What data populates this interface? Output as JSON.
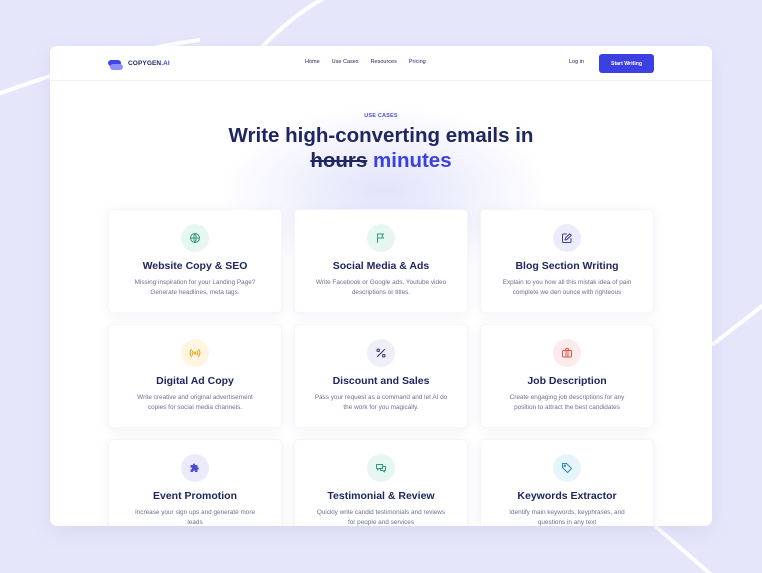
{
  "colors": {
    "accent": "#3d40e0",
    "heading": "#1f2660",
    "page_background": "#e6e6fb"
  },
  "header": {
    "logo_main": "COPYGEN",
    "logo_suffix": ".AI",
    "nav": [
      "Home",
      "Use Cases",
      "Resources",
      "Pricing"
    ],
    "login": "Log in",
    "cta": "Start Writing"
  },
  "hero": {
    "eyebrow": "USE CASES",
    "title_line1": "Write high-converting emails in",
    "struck_word": "hours",
    "accent_word": "minutes"
  },
  "cards": [
    {
      "title": "Website Copy & SEO",
      "desc": "Missing inspiration for your Landing Page?\nGenerate headlines, meta tags.",
      "icon": "globe-icon",
      "icon_bg": "#e6f6f1",
      "icon_color": "#2e9a7b"
    },
    {
      "title": "Social Media & Ads",
      "desc": "Write Facebook or Google ads, Youtube video\ndescriptions or titles.",
      "icon": "flag-icon",
      "icon_bg": "#e6f6f1",
      "icon_color": "#2e9a7b"
    },
    {
      "title": "Blog Section Writing",
      "desc": "Explain to you how all this mistak idea of pain\ncomplete we den ounce with righteous",
      "icon": "edit-icon",
      "icon_bg": "#ecebfb",
      "icon_color": "#3b3f9a"
    },
    {
      "title": "Digital Ad Copy",
      "desc": "Write creative and original advertisement\ncopies for social media channels.",
      "icon": "broadcast-icon",
      "icon_bg": "#fff5e1",
      "icon_color": "#e5a21b"
    },
    {
      "title": "Discount and Sales",
      "desc": "Pass your request as a command and let AI do\nthe work for you magically.",
      "icon": "percent-icon",
      "icon_bg": "#eeeff8",
      "icon_color": "#2c3170"
    },
    {
      "title": "Job Description",
      "desc": "Create engaging job descriptions for any\nposition to attract the best candidates",
      "icon": "briefcase-icon",
      "icon_bg": "#fdeaea",
      "icon_color": "#d9534f"
    },
    {
      "title": "Event Promotion",
      "desc": "Increase your sign ups and generate more\nleads",
      "icon": "puzzle-icon",
      "icon_bg": "#ecebfb",
      "icon_color": "#4b4fd6"
    },
    {
      "title": "Testimonial & Review",
      "desc": "Quickly write candid testimonials and reviews\nfor people and services",
      "icon": "chat-icon",
      "icon_bg": "#e6f6f1",
      "icon_color": "#2e9a7b"
    },
    {
      "title": "Keywords Extractor",
      "desc": "Identify main keywords, keyphrases, and\nquestions in any text",
      "icon": "tags-icon",
      "icon_bg": "#e6f5f9",
      "icon_color": "#2a8ca8"
    }
  ]
}
